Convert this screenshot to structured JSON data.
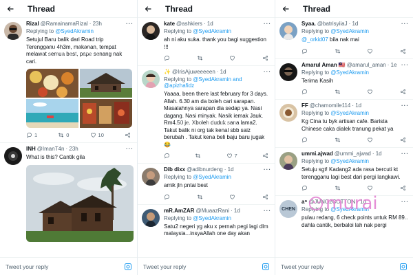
{
  "header_title": "Thread",
  "composer_placeholder": "Tweet your reply",
  "watermark": "murai",
  "colors": {
    "accent": "#1d9bf0",
    "text": "#0f1419",
    "muted": "#536471"
  },
  "panel1": {
    "t1": {
      "name": "Rizal",
      "handle": "@RamainamaRizal",
      "time": "· 23h",
      "reply_label": "Replying to",
      "reply_to": "@SyedAkramin",
      "text": "Setujul Baru balik dari Road trip Terengganu 4h3m, makanan, tempat melawat semua best, pape senang nak cari.",
      "replies": "1",
      "retweets": "0",
      "likes": "10"
    },
    "t2": {
      "name": "INH",
      "handle": "@ImanT4n",
      "time": "· 23h",
      "text": "What is this? Cantik gila"
    }
  },
  "panel2": {
    "t1": {
      "name": "kate",
      "handle": "@ashkiers",
      "time": "· 1d",
      "reply_label": "Replying to",
      "reply_to": "@SyedAkramin",
      "text": "ah ni aku suka. thank you bagi suggestion !!!"
    },
    "t2": {
      "name": "✨",
      "handle": "@IrisAjuweeeeen",
      "time": "· 1d",
      "reply_label": "Replying to",
      "reply_to": "@SyedAkramin and @apizhafidz",
      "text": "Yaaaa, been there last february for 3 days. Allah. 6.30 am da boleh cari sarapan. Masalahnya sarapan dia sedap ya. Nasi dagang. Nasi minyak. Nasik lemak Jauk. Rm4.50 je. Xboleh duduk sana lama2. Takut balik ni org tak kenal sbb saiz berubah . Takut kena beli baju baru jugak 😂",
      "likes": "7"
    },
    "t3": {
      "name": "Dib dixx",
      "handle": "@adibnurdeng",
      "time": "· 1d",
      "reply_label": "Replying to",
      "reply_to": "@SyedAkramin",
      "text": "amik jln pntai best"
    },
    "t4": {
      "name": "mR.AmZAR",
      "handle": "@MuaazRani",
      "time": "· 1d",
      "reply_label": "Replying to",
      "reply_to": "@SyedAkramin",
      "text": "Satu2 negeri yg aku x pernah pegi lagi dlm malaysia...insyaAllah one day akan"
    }
  },
  "panel3": {
    "t1": {
      "name": "Syaa.",
      "handle": "@batrisyiiaJ",
      "time": "· 1d",
      "reply_label": "Replying to",
      "reply_to": "@SyedAkramin",
      "mention": "@_orkid07",
      "text": " bila nak mai"
    },
    "t2": {
      "name": "Amarul Aman",
      "flag": "🇲🇾",
      "handle": "@amarul_aman",
      "time": "· 1e",
      "reply_label": "Replying to",
      "reply_to": "@SyedAkramin",
      "text": "Terima Kasih"
    },
    "t3": {
      "name": "FF",
      "handle": "@chamomile114",
      "time": "· 1d",
      "reply_label": "Replying to",
      "reply_to": "@SyedAkramin",
      "text": "Kg Cina tu byk artisan cafe. Barista Chinese caka dialek tranung pekat ya"
    },
    "t4": {
      "name": "ummi.ajwad",
      "handle": "@ummi_ajwad",
      "time": "· 1d",
      "reply_label": "Replying to",
      "reply_to": "@SyedAkramin",
      "text": "Setuju sgt! Kadang2 ada rasa bercuti kt terengganu lagi best dari pergi langkawi."
    },
    "t5": {
      "name": "a⁹",
      "handle": "@JUNO2COTTON",
      "time": "· 1d",
      "avatar_text": "CHEN",
      "reply_label": "Replying to",
      "reply_to": "@SyedAkramin",
      "text": "pulau redang, 6 check points untuk RM 89.. dahla cantik, berbaloi lah nak pergi"
    }
  }
}
